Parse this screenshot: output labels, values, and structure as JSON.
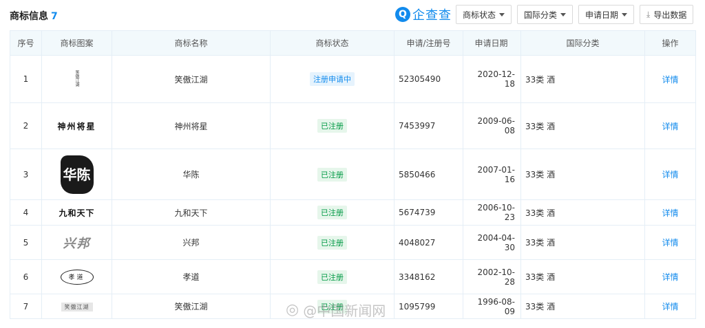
{
  "section": {
    "title": "商标信息",
    "count": "7"
  },
  "brand": {
    "icon": "Q",
    "name": "企查查"
  },
  "toolbar": {
    "status_label": "商标状态",
    "class_label": "国际分类",
    "date_label": "申请日期",
    "export_label": "导出数据"
  },
  "table": {
    "headers": {
      "num": "序号",
      "pic": "商标图案",
      "name": "商标名称",
      "status": "商标状态",
      "reg": "申请/注册号",
      "date": "申请日期",
      "cls": "国际分类",
      "op": "操作"
    },
    "rows": [
      {
        "num": "1",
        "logo_text": "笑傲江湖",
        "name": "笑傲江湖",
        "status": "注册申请中",
        "status_type": "pending",
        "reg": "52305490",
        "date": "2020-12-18",
        "cls": "33类 酒",
        "op": "详情"
      },
      {
        "num": "2",
        "logo_text": "神州将星",
        "name": "神州将星",
        "status": "已注册",
        "status_type": "ok",
        "reg": "7453997",
        "date": "2009-06-08",
        "cls": "33类 酒",
        "op": "详情"
      },
      {
        "num": "3",
        "logo_text": "华陈",
        "name": "华陈",
        "status": "已注册",
        "status_type": "ok",
        "reg": "5850466",
        "date": "2007-01-16",
        "cls": "33类 酒",
        "op": "详情"
      },
      {
        "num": "4",
        "logo_text": "九和天下",
        "name": "九和天下",
        "status": "已注册",
        "status_type": "ok",
        "reg": "5674739",
        "date": "2006-10-23",
        "cls": "33类 酒",
        "op": "详情"
      },
      {
        "num": "5",
        "logo_text": "兴邦",
        "name": "兴邦",
        "status": "已注册",
        "status_type": "ok",
        "reg": "4048027",
        "date": "2004-04-30",
        "cls": "33类 酒",
        "op": "详情"
      },
      {
        "num": "6",
        "logo_text": "孝道",
        "name": "孝道",
        "status": "已注册",
        "status_type": "ok",
        "reg": "3348162",
        "date": "2002-10-28",
        "cls": "33类 酒",
        "op": "详情"
      },
      {
        "num": "7",
        "logo_text": "笑傲江湖",
        "name": "笑傲江湖",
        "status": "已注册",
        "status_type": "ok",
        "reg": "1095799",
        "date": "1996-08-09",
        "cls": "33类 酒",
        "op": "详情"
      }
    ]
  },
  "watermark": {
    "text": "@中国新闻网"
  },
  "colors": {
    "accent": "#128bed",
    "registered": "#009944",
    "header_bg": "#f2f9fc"
  }
}
